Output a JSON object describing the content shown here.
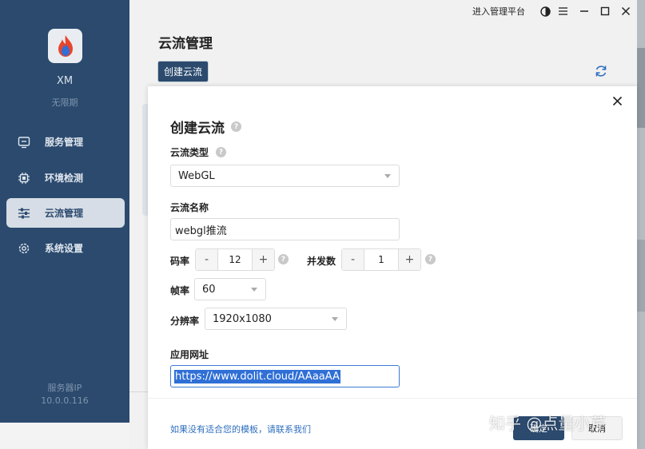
{
  "app": {
    "user_name": "XM",
    "user_subtitle": "无限期",
    "server_label": "服务器IP",
    "server_ip": "10.0.0.116",
    "accent_color": "#2b4a6e"
  },
  "sidebar": {
    "items": [
      {
        "label": "服务管理",
        "icon": "monitor-icon",
        "active": false
      },
      {
        "label": "环境检测",
        "icon": "chip-icon",
        "active": false
      },
      {
        "label": "云流管理",
        "icon": "sliders-icon",
        "active": true
      },
      {
        "label": "系统设置",
        "icon": "gear-icon",
        "active": false
      }
    ]
  },
  "topbar": {
    "admin_link": "进入管理平台"
  },
  "main": {
    "title": "云流管理",
    "create_button": "创建云流"
  },
  "dialog": {
    "title": "创建云流",
    "type_label": "云流类型",
    "type_value": "WebGL",
    "name_label": "云流名称",
    "name_value": "webgl推流",
    "bitrate_label": "码率",
    "bitrate_value": "12",
    "concurrency_label": "并发数",
    "concurrency_value": "1",
    "framerate_label": "帧率",
    "framerate_value": "60",
    "resolution_label": "分辨率",
    "resolution_value": "1920x1080",
    "url_label": "应用网址",
    "url_value": "https://www.dolit.cloud/AAaaAA",
    "footer_link": "如果没有适合您的模板，请联系我们",
    "ok_button": "确定",
    "cancel_button": "取消",
    "minus": "-",
    "plus": "+",
    "help": "?"
  },
  "watermark": "知乎 @点量小芹"
}
